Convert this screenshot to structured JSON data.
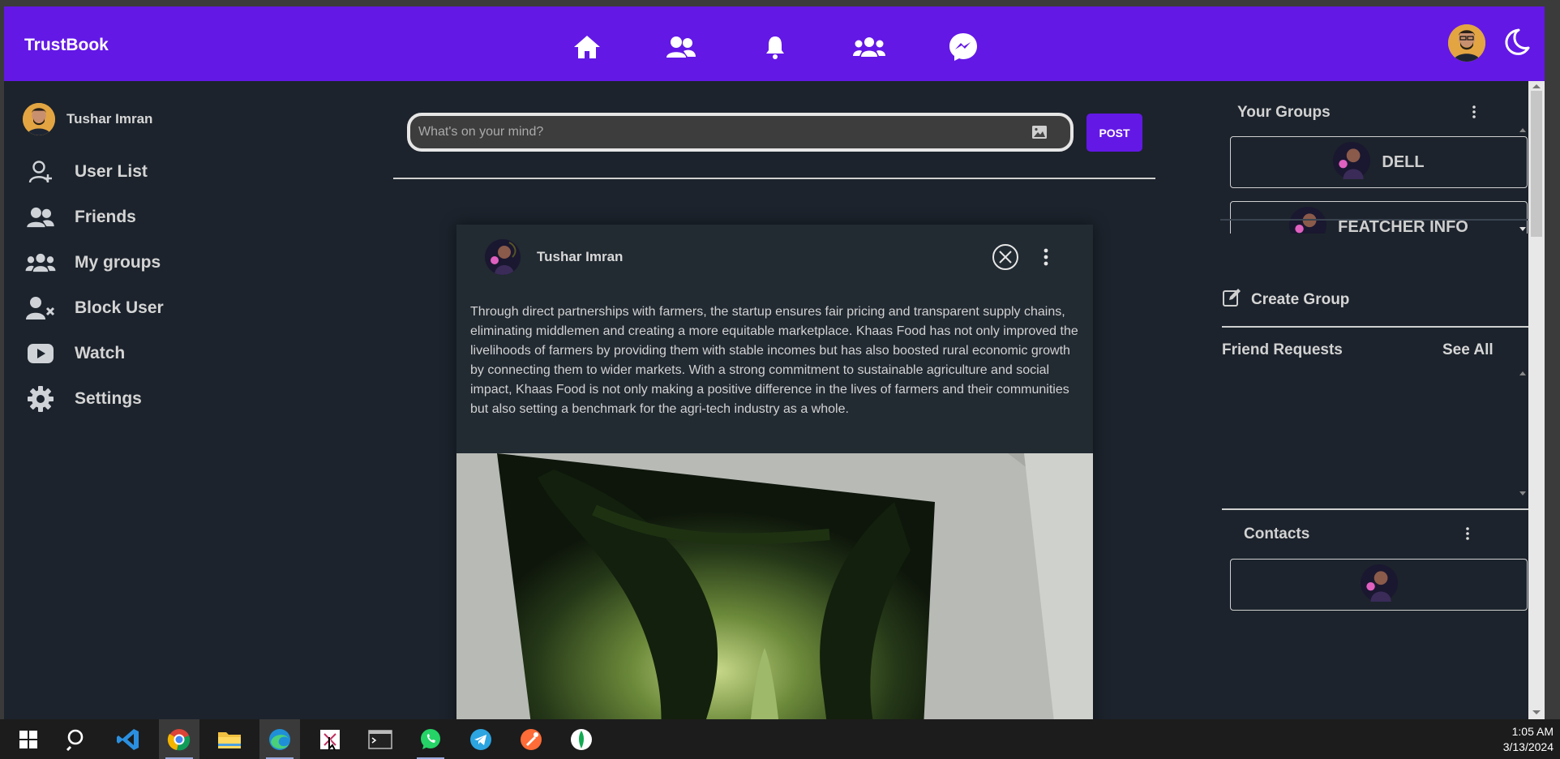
{
  "app": {
    "brand": "TrustBook"
  },
  "nav": {
    "icons": [
      "home-icon",
      "friends-icon",
      "bell-icon",
      "groups-icon",
      "messenger-icon"
    ],
    "accent": "#6318e6"
  },
  "sidebar": {
    "user_name": "Tushar Imran",
    "items": [
      {
        "label": "User List",
        "icon": "user-add-icon"
      },
      {
        "label": "Friends",
        "icon": "friends-icon"
      },
      {
        "label": "My groups",
        "icon": "groups-icon"
      },
      {
        "label": "Block User",
        "icon": "user-block-icon"
      },
      {
        "label": "Watch",
        "icon": "youtube-icon"
      },
      {
        "label": "Settings",
        "icon": "gear-icon"
      }
    ]
  },
  "composer": {
    "placeholder": "What's on your mind?",
    "post_label": "POST"
  },
  "post": {
    "author": "Tushar Imran",
    "text": "Through direct partnerships with farmers, the startup ensures fair pricing and transparent supply chains, eliminating middlemen and creating a more equitable marketplace. Khaas Food has not only improved the livelihoods of farmers by providing them with stable incomes but has also boosted rural economic growth by connecting them to wider markets. With a strong commitment to sustainable agriculture and social impact, Khaas Food is not only making a positive difference in the lives of farmers and their communities but also setting a benchmark for the agri-tech industry as a whole."
  },
  "right": {
    "groups_title": "Your Groups",
    "groups": [
      {
        "name": "DELL"
      },
      {
        "name": "FEATCHER INFO"
      }
    ],
    "create_group": "Create Group",
    "friend_requests_title": "Friend Requests",
    "see_all": "See All",
    "contacts_title": "Contacts"
  },
  "taskbar": {
    "apps": [
      "start-icon",
      "search-icon",
      "vscode-icon",
      "chrome-icon",
      "file-explorer-icon",
      "edge-icon",
      "snipping-tool-icon",
      "terminal-icon",
      "whatsapp-icon",
      "telegram-icon",
      "postman-icon",
      "mongodb-icon"
    ],
    "time": "1:05 AM",
    "date": "3/13/2024"
  }
}
